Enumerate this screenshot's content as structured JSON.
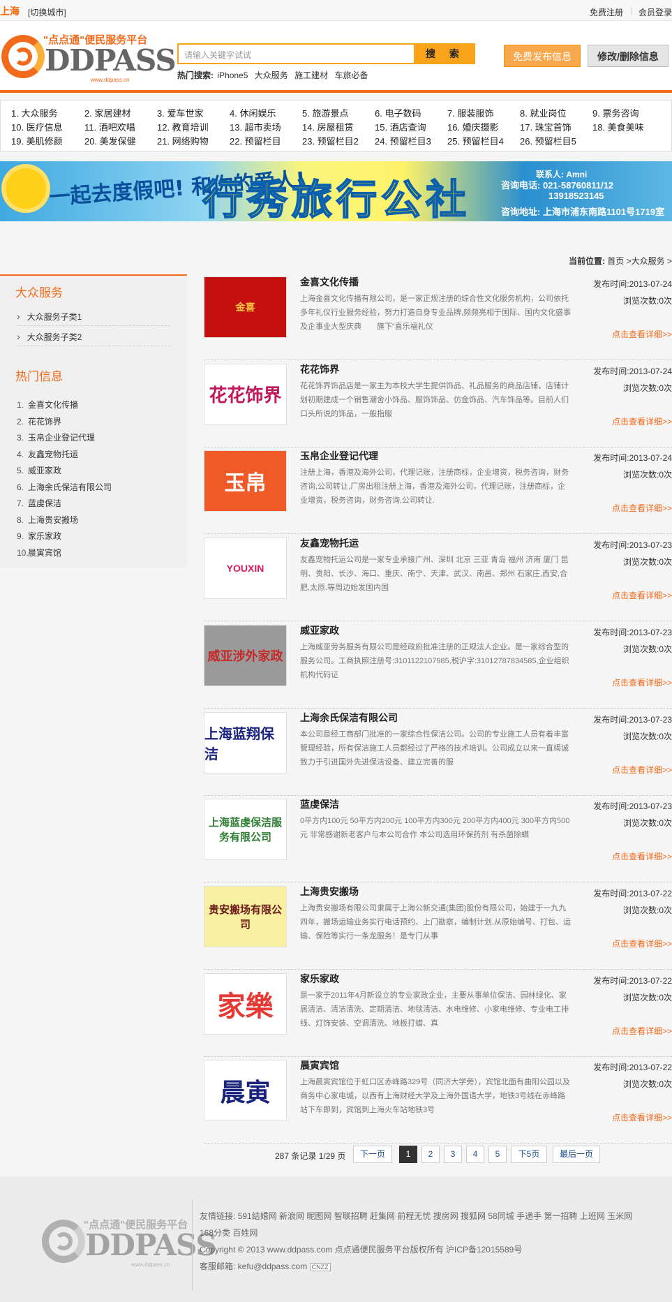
{
  "topbar": {
    "city": "上海",
    "switch_city": "[切换城市]",
    "register": "免费注册",
    "login": "会员登录"
  },
  "header": {
    "logo_slogan": "\"点点通\"便民服务平台",
    "logo_brand": "DDPASS",
    "logo_url": "www.ddpass.cn",
    "search_placeholder": "请输入关键字试试",
    "search_button": "搜 索",
    "hot_label": "热门搜索:",
    "hot_terms": [
      "iPhone5",
      "大众服务",
      "施工建材",
      "车旅必备"
    ],
    "publish_button": "免费发布信息",
    "modify_button": "修改/删除信息"
  },
  "categories": [
    "1. 大众服务",
    "2. 家居建材",
    "3. 爱车世家",
    "4. 休闲娱乐",
    "5. 旅游景点",
    "6. 电子数码",
    "7. 服装服饰",
    "8. 就业岗位",
    "9. 票务咨询",
    "10. 医疗信息",
    "11. 酒吧欢唱",
    "12. 教育培训",
    "13. 超市卖场",
    "14. 房屋租赁",
    "15. 酒店查询",
    "16. 婚庆摄影",
    "17. 珠宝首饰",
    "18. 美食美味",
    "19. 美肌修颜",
    "20. 美发保健",
    "21. 网络购物",
    "22. 预留栏目",
    "23. 预留栏目2",
    "24. 预留栏目3",
    "25. 预留栏目4",
    "26. 预留栏目5"
  ],
  "banner": {
    "slogan": "一起去度假吧! 和你的爱人!",
    "name": "行秀旅行公社",
    "contact_person": "联系人: Amni",
    "phone_label": "咨询电话: 021-58760811/12",
    "phone2": "13918523145",
    "address": "咨询地址: 上海市浦东南路1101号1719室"
  },
  "crumb": {
    "label": "当前位置:",
    "home": "首页",
    "current": ">大众服务 >"
  },
  "sidebar": {
    "title": "大众服务",
    "subs": [
      "大众服务子类1",
      "大众服务子类2"
    ],
    "hot_title": "热门信息",
    "hot": [
      "金喜文化传播",
      "花花饰界",
      "玉帛企业登记代理",
      "友鑫宠物托运",
      "威亚家政",
      "上海余氏保洁有限公司",
      "蓝虔保洁",
      "上海贵安搬场",
      "家乐家政",
      "晨寅宾馆"
    ]
  },
  "labels": {
    "date": "发布时间:",
    "views": "浏览次数:",
    "views_count": "0次",
    "more": "点击查看详细>>"
  },
  "items": [
    {
      "title": "金喜文化传播",
      "desc": "上海金喜文化传播有限公司，是一家正规注册的综合性文化服务机构，公司依托多年礼仪行业服务经验，努力打造自身专业品牌,频频亮相于国际、国内文化盛事及企事业大型庆典　　旗下“喜乐福礼仪",
      "date": "2013-07-24",
      "thumb": "金喜"
    },
    {
      "title": "花花饰界",
      "desc": "\n花花饰界饰品店是一家主为本校大学生提供饰品、礼品服务的商品店铺，店铺计划初期建成一个销售潮舍小饰品、服饰饰品、仿金饰品、汽车饰品等。目前人们口头所说的饰品，一般指服",
      "date": "2013-07-24",
      "thumb": "花花饰界"
    },
    {
      "title": "玉帛企业登记代理",
      "desc": "注册上海，香港及海外公司，代理记账，注册商标，企业增资，税务咨询，财务咨询,公司转让,厂房出租注册上海，香港及海外公司，代理记账，注册商标，企业增资，税务咨询，财务咨询,公司转让.",
      "date": "2013-07-24",
      "thumb": "玉帛"
    },
    {
      "title": "友鑫宠物托运",
      "desc": "友鑫宠物托运公司是一家专业承接广州、深圳 北京 三亚 青岛 福州 济南 厦门 昆明、贵阳、长沙、海口、重庆、南宁、天津、武汉、南昌、郑州 石家庄,西安,合肥,太原.等周边始发国内国",
      "date": "2013-07-23",
      "thumb": "YOUXIN"
    },
    {
      "title": "威亚家政",
      "desc": "上海威亚劳务服务有限公司是经政府批准注册的正规法人企业。是一家综合型的服务公司。工商执照注册号:3101122107985,税沪字:31012787834585,企业组织机构代码证",
      "date": "2013-07-23",
      "thumb": "威亚涉外家政"
    },
    {
      "title": "上海余氏保洁有限公司",
      "desc": "本公司是经工商部门批准的一家综合性保洁公司。公司的专业施工人员有着丰富管理经验，所有保洁施工人员都经过了严格的技术培训。公司成立以来一直竭诚致力于引进国外先进保洁设备、建立完善的服",
      "date": "2013-07-23",
      "thumb": "上海蓝翔保洁"
    },
    {
      "title": "蓝虔保洁",
      "desc": "0平方内100元  50平方内200元  100平方内300元  200平方内400元  300平方内500元\n非常感谢新老客户与本公司合作  本公司选用环保药剂  有杀菌除螨",
      "date": "2013-07-23",
      "thumb": "上海蓝虔保洁服务有限公司"
    },
    {
      "title": "上海贵安搬场",
      "desc": "上海贵安搬场有限公司隶属于上海公新交通(集团)股份有限公司，始建于一九九四年，搬场运输业务实行电话预约、上门勘察，编制计划,从原始编号、打包、运输、保险等实行一条龙服务！是专门从事",
      "date": "2013-07-22",
      "thumb": "贵安搬场有限公司"
    },
    {
      "title": "家乐家政",
      "desc": "是一家于2011年4月新设立的专业家政企业，主要从事单位保洁、园林绿化、家居清洁、清洁清洗、定期清洁、地毯清洁、水电维修、小家电维修、专业电工排线、灯饰安装、空调清洗、地板打蜡、真",
      "date": "2013-07-22",
      "thumb": "家樂"
    },
    {
      "title": "晨寅宾馆",
      "desc": "上海晨寅宾馆位于虹口区赤峰路329号（同济大学旁），宾馆北面有曲阳公园以及商务中心家电城，以西有上海财经大学及上海外国语大学，地铁3号线在赤峰路站下车即到，宾馆到上海火车站地铁3号",
      "date": "2013-07-22",
      "thumb": "晨寅"
    }
  ],
  "pager": {
    "info": "287 条记录  1/29 页",
    "prev": "下一页",
    "pages": [
      "1",
      "2",
      "3",
      "4",
      "5"
    ],
    "next5": "下5页",
    "last": "最后一页"
  },
  "footer": {
    "links_label": "友情链接:",
    "links": "591结婚网 新浪网 昵图网 智联招聘 赶集网 前程无忧 搜房网 搜狐网 58同城 手递手 第一招聘 上班网 玉米网",
    "links2": "168分类 百姓网",
    "copyright": "Copyright © 2013 www.ddpass.com 点点通便民服务平台版权所有  沪ICP备12015589号",
    "email": "客服邮箱: kefu@ddpass.com",
    "cnzz": "CNZZ"
  }
}
